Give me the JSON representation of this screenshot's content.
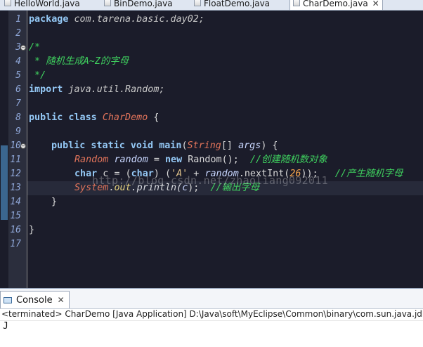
{
  "tabs": [
    "HelloWorld.java",
    "BinDemo.java",
    "FloatDemo.java",
    "CharDemo.java"
  ],
  "line_numbers": [
    "1",
    "2",
    "3",
    "4",
    "5",
    "6",
    "7",
    "8",
    "9",
    "10",
    "11",
    "12",
    "13",
    "14",
    "15",
    "16",
    "17"
  ],
  "code": {
    "l1_kw": "package",
    "l1_pkg": " com.tarena.basic.day02;",
    "l3": "/*",
    "l4": " * 随机生成A~Z的字母",
    "l5": " */",
    "l6_kw": "import",
    "l6_pkg": " java.util.Random;",
    "l8_kw": "public class",
    "l8_cls": "CharDemo",
    "l8_brace": " {",
    "l10_kw": "public static void",
    "l10_main": "main",
    "l10_paren": "(",
    "l10_type": "String",
    "l10_brackets": "[] ",
    "l10_arg": "args",
    "l10_end": ") {",
    "l11_type": "Random",
    "l11_var": "random",
    "l11_eq": " = ",
    "l11_new": "new",
    "l11_ctor": " Random();",
    "l11_cm": "//创建随机数对象",
    "l12_kw1": "char",
    "l12_c": " c ",
    "l12_eq": "= (",
    "l12_kw2": "char",
    "l12_paren": ") (",
    "l12_str": "'A'",
    "l12_plus": " + ",
    "l12_rnd": "random",
    "l12_call": ".nextInt(",
    "l12_num": "26",
    "l12_end": "));",
    "l12_cm": "//产生随机字母",
    "l13_sys": "System",
    "l13_dot": ".",
    "l13_out": "out",
    "l13_call": ".println(",
    "l13_c": "c",
    "l13_end": ");",
    "l13_cm": "//输出字母",
    "l14": "}",
    "l16": "}"
  },
  "watermark": "http://blog.csdn.net/zhaoliang092011",
  "console": {
    "tab_label": "Console",
    "status": "<terminated> CharDemo [Java Application] D:\\Java\\soft\\MyEclipse\\Common\\binary\\com.sun.java.jdk.w",
    "output": "J"
  },
  "colors": {
    "editor_bg": "#1b1c2a",
    "keyword": "#94c8f5",
    "comment": "#3fd25f",
    "class_name": "#e0735a"
  }
}
